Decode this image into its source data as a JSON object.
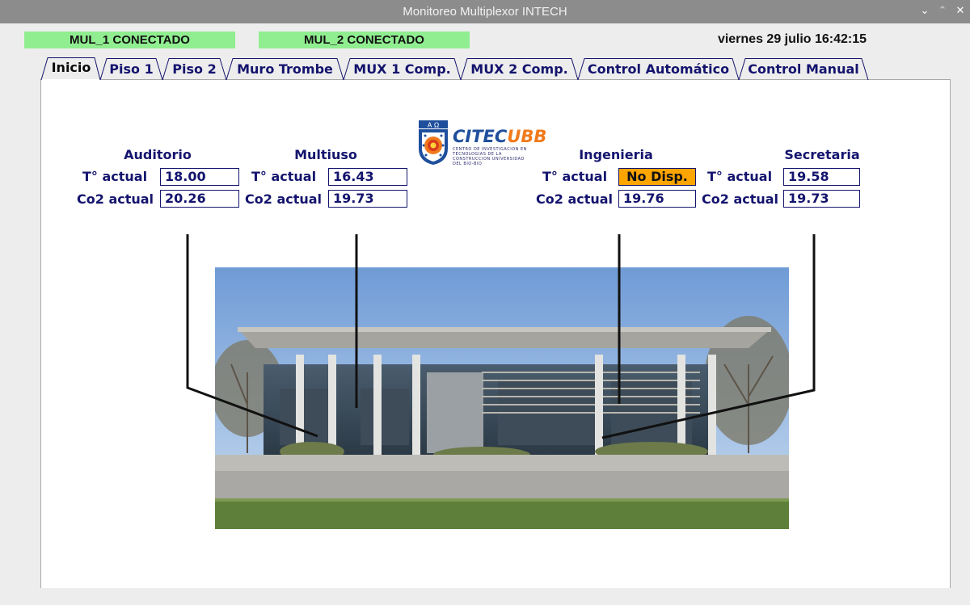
{
  "window": {
    "title": "Monitoreo Multiplexor INTECH",
    "btn_minimize": "⌄",
    "btn_maximize": "⌃",
    "btn_close": "✕"
  },
  "status": {
    "mul1": "MUL_1 CONECTADO",
    "mul2": "MUL_2 CONECTADO",
    "connected_color": "#90ee90",
    "datetime": "viernes 29 julio 16:42:15"
  },
  "tabs": [
    {
      "label": "Inicio",
      "active": true
    },
    {
      "label": "Piso 1"
    },
    {
      "label": "Piso 2"
    },
    {
      "label": "Muro Trombe"
    },
    {
      "label": "MUX 1 Comp."
    },
    {
      "label": "MUX 2 Comp."
    },
    {
      "label": "Control Automático"
    },
    {
      "label": "Control Manual"
    }
  ],
  "logo": {
    "name_a": "CITEC",
    "name_b": "UBB",
    "subtitle": "CENTRO DE INVESTIGACION EN TECNOLOGIAS DE LA CONSTRUCCION UNIVERSIDAD DEL BIO-BIO"
  },
  "rooms": {
    "auditorio": {
      "name": "Auditorio",
      "temp_label": "T° actual",
      "temp": "18.00",
      "co2_label": "Co2 actual",
      "co2": "20.26"
    },
    "multiuso": {
      "name": "Multiuso",
      "temp_label": "T° actual",
      "temp": "16.43",
      "co2_label": "Co2 actual",
      "co2": "19.73"
    },
    "ingenieria": {
      "name": "Ingenieria",
      "temp_label": "T° actual",
      "temp": "No Disp.",
      "co2_label": "Co2 actual",
      "co2": "19.76"
    },
    "secretaria": {
      "name": "Secretaria",
      "temp_label": "T° actual",
      "temp": "19.58",
      "co2_label": "Co2 actual",
      "co2": "19.73"
    }
  },
  "colors": {
    "label_text": "#14146e",
    "not_available": "#ffa500"
  }
}
